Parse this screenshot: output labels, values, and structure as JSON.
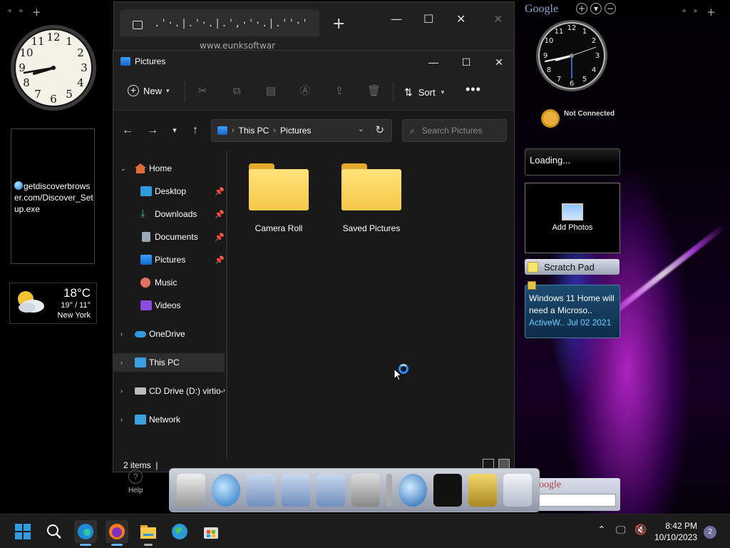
{
  "desktop": {
    "url_gadget": {
      "text": "getdiscoverbrowser.com/Discover_Setup.exe"
    },
    "weather": {
      "temperature": "18°C",
      "range": "19° / 11°",
      "city": "New York"
    },
    "google_logo": "Google",
    "not_connected": "Not Connected",
    "loading": "Loading...",
    "add_photos": "Add Photos",
    "scratch_pad": "Scratch Pad",
    "news": {
      "headline": "Windows 11 Home will need a Microso..",
      "meta": "ActiveW.. Jul 02 2021"
    },
    "google_search_logo": "oogle",
    "clocks": [
      {
        "hour": 8,
        "minute": 42
      },
      {
        "hour": 8,
        "minute": 42
      }
    ]
  },
  "browser": {
    "tab_title": ".'·.|.'·.|.',·'·.|.''·'·.|",
    "address": "www.eunksoftwar"
  },
  "explorer": {
    "title": "Pictures",
    "commands": {
      "new_label": "New",
      "sort_label": "Sort"
    },
    "breadcrumb": [
      "This PC",
      "Pictures"
    ],
    "search_placeholder": "Search Pictures",
    "nav": [
      {
        "label": "Home",
        "expandable": true,
        "expanded": true
      },
      {
        "label": "Desktop",
        "pinned": true
      },
      {
        "label": "Downloads",
        "pinned": true
      },
      {
        "label": "Documents",
        "pinned": true
      },
      {
        "label": "Pictures",
        "pinned": true
      },
      {
        "label": "Music"
      },
      {
        "label": "Videos"
      },
      {
        "label": "OneDrive",
        "expandable": true
      },
      {
        "label": "This PC",
        "expandable": true,
        "selected": true
      },
      {
        "label": "CD Drive (D:) virtio-w",
        "expandable": true
      },
      {
        "label": "Network",
        "expandable": true
      }
    ],
    "items": [
      {
        "name": "Camera Roll"
      },
      {
        "name": "Saved Pictures"
      }
    ],
    "status": "2 items",
    "help_label": "Help"
  },
  "taskbar": {
    "time": "8:42 PM",
    "date": "10/10/2023",
    "notifications": "2"
  },
  "colors": {
    "accent": "#2a8cff",
    "folder": "#f6c949",
    "taskbar": "#1c1c1c"
  }
}
